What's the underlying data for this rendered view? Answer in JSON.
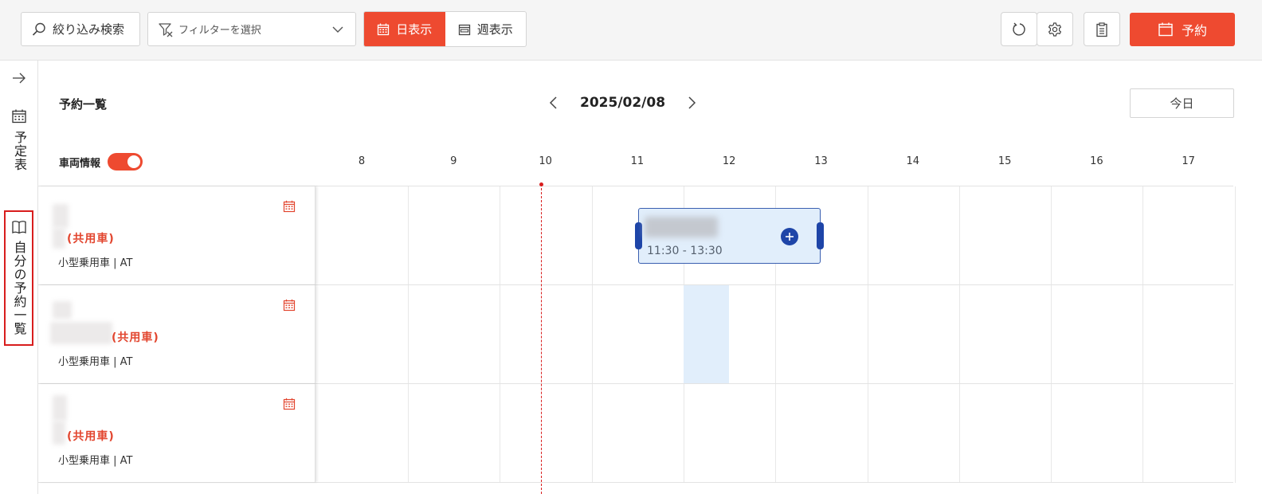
{
  "toolbar": {
    "search_label": "絞り込み検索",
    "filter_placeholder": "フィルターを選択",
    "view_day": "日表示",
    "view_week": "週表示",
    "reserve_label": "予約"
  },
  "sidebar": {
    "items": [
      {
        "label": "予定表",
        "icon": "calendar-icon"
      },
      {
        "label": "自分の予約一覧",
        "icon": "book-icon"
      }
    ]
  },
  "main": {
    "title": "予約一覧",
    "date": "2025/02/08",
    "today_label": "今日",
    "vehicle_info_label": "車両情報",
    "vehicle_info_on": true,
    "hours": [
      "8",
      "9",
      "10",
      "11",
      "12",
      "13",
      "14",
      "15",
      "16",
      "17"
    ]
  },
  "vehicles": [
    {
      "shared": "(共用車)",
      "spec": "小型乗用車 | AT"
    },
    {
      "shared": "(共用車)",
      "spec": "小型乗用車 | AT"
    },
    {
      "shared": "(共用車)",
      "spec": "小型乗用車 | AT"
    }
  ],
  "booking": {
    "time": "11:30 - 13:30"
  },
  "colors": {
    "accent": "#ee4a30",
    "booking_fill": "#e1eefb",
    "booking_handle": "#1e45a8",
    "now_line": "#d81d1d"
  }
}
